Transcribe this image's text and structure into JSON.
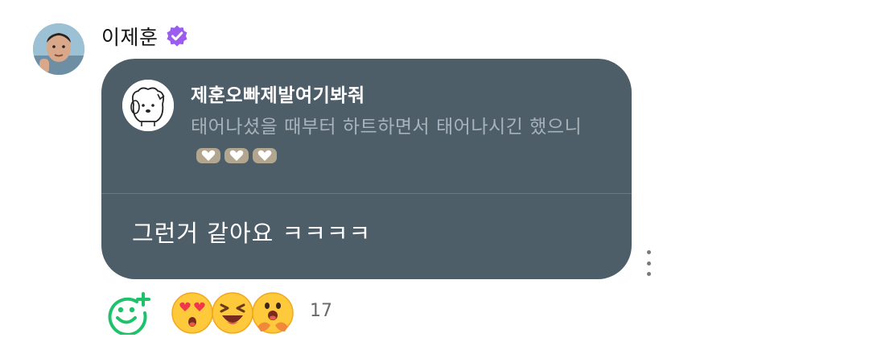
{
  "comment": {
    "author": "이제훈",
    "author_avatar_icon": "profile-photo",
    "verified_icon": "verified-badge-icon",
    "accent_color": "#9b5cf2",
    "bubble_color": "#4e5e69",
    "quoted": {
      "author": "제훈오빠제발여기봐줘",
      "author_avatar_icon": "cartoon-dog-avatar",
      "text": "태어나셨을 때부터 하트하면서 태어나시긴 했으니",
      "trailing_emojis": [
        "heart-hands-emoji",
        "heart-hands-emoji",
        "heart-hands-emoji"
      ]
    },
    "reply": "그런거 같아요 ㅋㅋㅋㅋ",
    "more_icon": "vertical-ellipsis-icon"
  },
  "reactions": {
    "add_icon": "add-reaction-icon",
    "add_color": "#1ec26a",
    "emojis": [
      "heart-eyes-emoji",
      "laughing-emoji",
      "hugging-emoji"
    ],
    "count": "17"
  }
}
